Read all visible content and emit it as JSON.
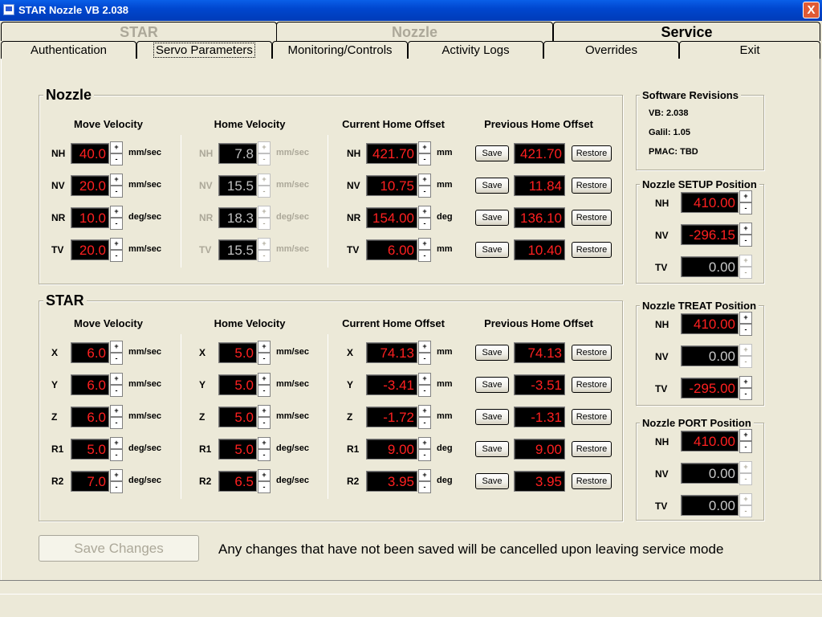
{
  "title": "STAR Nozzle VB 2.038",
  "top_tabs": [
    "STAR",
    "Nozzle",
    "Service"
  ],
  "sub_tabs": [
    "Authentication",
    "Servo Parameters",
    "Monitoring/Controls",
    "Activity Logs",
    "Overrides",
    "Exit"
  ],
  "headers": {
    "move": "Move Velocity",
    "home": "Home Velocity",
    "cur": "Current Home Offset",
    "prev": "Previous Home Offset"
  },
  "nozzle": {
    "title": "Nozzle",
    "rows": [
      {
        "axis": "NH",
        "move": "40.0",
        "move_unit": "mm/sec",
        "home": "7.8",
        "home_unit": "mm/sec",
        "cur": "421.70",
        "cur_unit": "mm",
        "prev": "421.70"
      },
      {
        "axis": "NV",
        "move": "20.0",
        "move_unit": "mm/sec",
        "home": "15.5",
        "home_unit": "mm/sec",
        "cur": "10.75",
        "cur_unit": "mm",
        "prev": "11.84"
      },
      {
        "axis": "NR",
        "move": "10.0",
        "move_unit": "deg/sec",
        "home": "18.3",
        "home_unit": "deg/sec",
        "cur": "154.00",
        "cur_unit": "deg",
        "prev": "136.10"
      },
      {
        "axis": "TV",
        "move": "20.0",
        "move_unit": "mm/sec",
        "home": "15.5",
        "home_unit": "mm/sec",
        "cur": "6.00",
        "cur_unit": "mm",
        "prev": "10.40"
      }
    ]
  },
  "star": {
    "title": "STAR",
    "rows": [
      {
        "axis": "X",
        "move": "6.0",
        "move_unit": "mm/sec",
        "home": "5.0",
        "home_unit": "mm/sec",
        "cur": "74.13",
        "cur_unit": "mm",
        "prev": "74.13"
      },
      {
        "axis": "Y",
        "move": "6.0",
        "move_unit": "mm/sec",
        "home": "5.0",
        "home_unit": "mm/sec",
        "cur": "-3.41",
        "cur_unit": "mm",
        "prev": "-3.51"
      },
      {
        "axis": "Z",
        "move": "6.0",
        "move_unit": "mm/sec",
        "home": "5.0",
        "home_unit": "mm/sec",
        "cur": "-1.72",
        "cur_unit": "mm",
        "prev": "-1.31"
      },
      {
        "axis": "R1",
        "move": "5.0",
        "move_unit": "deg/sec",
        "home": "5.0",
        "home_unit": "deg/sec",
        "cur": "9.00",
        "cur_unit": "deg",
        "prev": "9.00"
      },
      {
        "axis": "R2",
        "move": "7.0",
        "move_unit": "deg/sec",
        "home": "6.5",
        "home_unit": "deg/sec",
        "cur": "3.95",
        "cur_unit": "deg",
        "prev": "3.95"
      }
    ]
  },
  "save_label": "Save",
  "restore_label": "Restore",
  "software": {
    "title": "Software Revisions",
    "lines": [
      "VB: 2.038",
      "Galil: 1.05",
      "PMAC: TBD"
    ]
  },
  "positions": [
    {
      "title": "Nozzle SETUP Position",
      "rows": [
        {
          "axis": "NH",
          "value": "410.00"
        },
        {
          "axis": "NV",
          "value": "-296.15"
        },
        {
          "axis": "TV",
          "value": "0.00"
        }
      ]
    },
    {
      "title": "Nozzle TREAT Position",
      "rows": [
        {
          "axis": "NH",
          "value": "410.00"
        },
        {
          "axis": "NV",
          "value": "0.00"
        },
        {
          "axis": "TV",
          "value": "-295.00"
        }
      ]
    },
    {
      "title": "Nozzle PORT Position",
      "rows": [
        {
          "axis": "NH",
          "value": "410.00"
        },
        {
          "axis": "NV",
          "value": "0.00"
        },
        {
          "axis": "TV",
          "value": "0.00"
        }
      ]
    }
  ],
  "save_changes": "Save Changes",
  "note": "Any changes that have not been saved will be cancelled upon leaving service mode",
  "spin_up": "+",
  "spin_down": "-",
  "close": "X"
}
